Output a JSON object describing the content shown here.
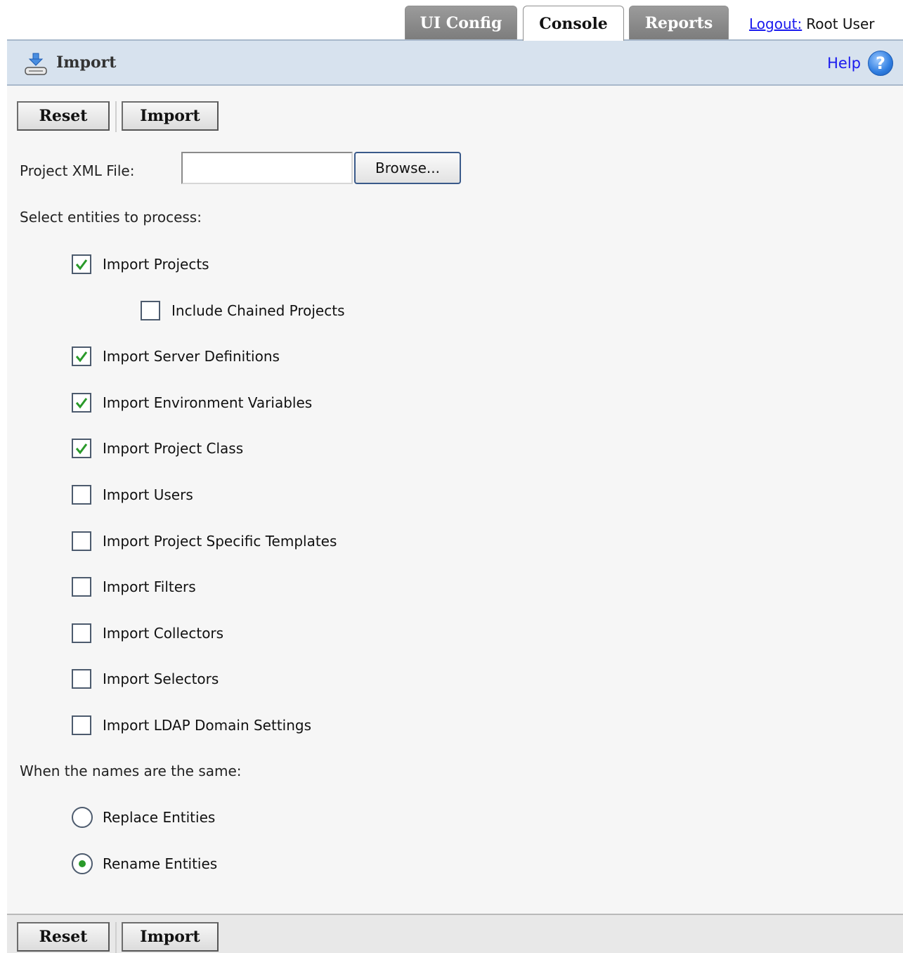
{
  "tabs": [
    {
      "label": "UI Config",
      "active": false
    },
    {
      "label": "Console",
      "active": true
    },
    {
      "label": "Reports",
      "active": false
    }
  ],
  "session": {
    "logout_label": "Logout:",
    "user_name": "Root User"
  },
  "header": {
    "title": "Import",
    "icon": "import-drive-icon",
    "help_label": "Help",
    "help_icon": "question-circle-icon"
  },
  "toolbar": {
    "reset_label": "Reset",
    "import_label": "Import"
  },
  "form": {
    "file_label": "Project XML File:",
    "file_value": "",
    "browse_label": "Browse...",
    "entities_label": "Select entities to process:",
    "entities": [
      {
        "label": "Import Projects",
        "checked": true,
        "indent": 0
      },
      {
        "label": "Include Chained Projects",
        "checked": false,
        "indent": 1
      },
      {
        "label": "Import Server Definitions",
        "checked": true,
        "indent": 0
      },
      {
        "label": "Import Environment Variables",
        "checked": true,
        "indent": 0
      },
      {
        "label": "Import Project Class",
        "checked": true,
        "indent": 0
      },
      {
        "label": "Import Users",
        "checked": false,
        "indent": 0
      },
      {
        "label": "Import Project Specific Templates",
        "checked": false,
        "indent": 0
      },
      {
        "label": "Import Filters",
        "checked": false,
        "indent": 0
      },
      {
        "label": "Import Collectors",
        "checked": false,
        "indent": 0
      },
      {
        "label": "Import Selectors",
        "checked": false,
        "indent": 0
      },
      {
        "label": "Import LDAP Domain Settings",
        "checked": false,
        "indent": 0
      }
    ],
    "conflict_label": "When the names are the same:",
    "conflict_options": [
      {
        "label": "Replace Entities",
        "selected": false
      },
      {
        "label": "Rename Entities",
        "selected": true
      }
    ]
  },
  "colors": {
    "header_bg": "#d7e2ee",
    "link": "#1a1aee",
    "check": "#2a9a2a"
  }
}
